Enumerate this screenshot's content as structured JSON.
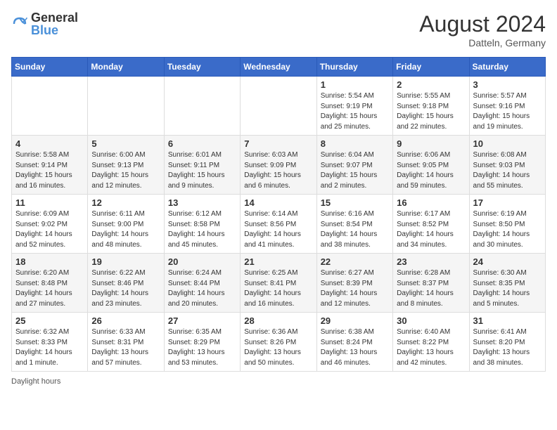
{
  "header": {
    "logo": {
      "general": "General",
      "blue": "Blue"
    },
    "title": "August 2024",
    "location": "Datteln, Germany"
  },
  "weekdays": [
    "Sunday",
    "Monday",
    "Tuesday",
    "Wednesday",
    "Thursday",
    "Friday",
    "Saturday"
  ],
  "weeks": [
    [
      {
        "day": "",
        "info": ""
      },
      {
        "day": "",
        "info": ""
      },
      {
        "day": "",
        "info": ""
      },
      {
        "day": "",
        "info": ""
      },
      {
        "day": "1",
        "info": "Sunrise: 5:54 AM\nSunset: 9:19 PM\nDaylight: 15 hours\nand 25 minutes."
      },
      {
        "day": "2",
        "info": "Sunrise: 5:55 AM\nSunset: 9:18 PM\nDaylight: 15 hours\nand 22 minutes."
      },
      {
        "day": "3",
        "info": "Sunrise: 5:57 AM\nSunset: 9:16 PM\nDaylight: 15 hours\nand 19 minutes."
      }
    ],
    [
      {
        "day": "4",
        "info": "Sunrise: 5:58 AM\nSunset: 9:14 PM\nDaylight: 15 hours\nand 16 minutes."
      },
      {
        "day": "5",
        "info": "Sunrise: 6:00 AM\nSunset: 9:13 PM\nDaylight: 15 hours\nand 12 minutes."
      },
      {
        "day": "6",
        "info": "Sunrise: 6:01 AM\nSunset: 9:11 PM\nDaylight: 15 hours\nand 9 minutes."
      },
      {
        "day": "7",
        "info": "Sunrise: 6:03 AM\nSunset: 9:09 PM\nDaylight: 15 hours\nand 6 minutes."
      },
      {
        "day": "8",
        "info": "Sunrise: 6:04 AM\nSunset: 9:07 PM\nDaylight: 15 hours\nand 2 minutes."
      },
      {
        "day": "9",
        "info": "Sunrise: 6:06 AM\nSunset: 9:05 PM\nDaylight: 14 hours\nand 59 minutes."
      },
      {
        "day": "10",
        "info": "Sunrise: 6:08 AM\nSunset: 9:03 PM\nDaylight: 14 hours\nand 55 minutes."
      }
    ],
    [
      {
        "day": "11",
        "info": "Sunrise: 6:09 AM\nSunset: 9:02 PM\nDaylight: 14 hours\nand 52 minutes."
      },
      {
        "day": "12",
        "info": "Sunrise: 6:11 AM\nSunset: 9:00 PM\nDaylight: 14 hours\nand 48 minutes."
      },
      {
        "day": "13",
        "info": "Sunrise: 6:12 AM\nSunset: 8:58 PM\nDaylight: 14 hours\nand 45 minutes."
      },
      {
        "day": "14",
        "info": "Sunrise: 6:14 AM\nSunset: 8:56 PM\nDaylight: 14 hours\nand 41 minutes."
      },
      {
        "day": "15",
        "info": "Sunrise: 6:16 AM\nSunset: 8:54 PM\nDaylight: 14 hours\nand 38 minutes."
      },
      {
        "day": "16",
        "info": "Sunrise: 6:17 AM\nSunset: 8:52 PM\nDaylight: 14 hours\nand 34 minutes."
      },
      {
        "day": "17",
        "info": "Sunrise: 6:19 AM\nSunset: 8:50 PM\nDaylight: 14 hours\nand 30 minutes."
      }
    ],
    [
      {
        "day": "18",
        "info": "Sunrise: 6:20 AM\nSunset: 8:48 PM\nDaylight: 14 hours\nand 27 minutes."
      },
      {
        "day": "19",
        "info": "Sunrise: 6:22 AM\nSunset: 8:46 PM\nDaylight: 14 hours\nand 23 minutes."
      },
      {
        "day": "20",
        "info": "Sunrise: 6:24 AM\nSunset: 8:44 PM\nDaylight: 14 hours\nand 20 minutes."
      },
      {
        "day": "21",
        "info": "Sunrise: 6:25 AM\nSunset: 8:41 PM\nDaylight: 14 hours\nand 16 minutes."
      },
      {
        "day": "22",
        "info": "Sunrise: 6:27 AM\nSunset: 8:39 PM\nDaylight: 14 hours\nand 12 minutes."
      },
      {
        "day": "23",
        "info": "Sunrise: 6:28 AM\nSunset: 8:37 PM\nDaylight: 14 hours\nand 8 minutes."
      },
      {
        "day": "24",
        "info": "Sunrise: 6:30 AM\nSunset: 8:35 PM\nDaylight: 14 hours\nand 5 minutes."
      }
    ],
    [
      {
        "day": "25",
        "info": "Sunrise: 6:32 AM\nSunset: 8:33 PM\nDaylight: 14 hours\nand 1 minute."
      },
      {
        "day": "26",
        "info": "Sunrise: 6:33 AM\nSunset: 8:31 PM\nDaylight: 13 hours\nand 57 minutes."
      },
      {
        "day": "27",
        "info": "Sunrise: 6:35 AM\nSunset: 8:29 PM\nDaylight: 13 hours\nand 53 minutes."
      },
      {
        "day": "28",
        "info": "Sunrise: 6:36 AM\nSunset: 8:26 PM\nDaylight: 13 hours\nand 50 minutes."
      },
      {
        "day": "29",
        "info": "Sunrise: 6:38 AM\nSunset: 8:24 PM\nDaylight: 13 hours\nand 46 minutes."
      },
      {
        "day": "30",
        "info": "Sunrise: 6:40 AM\nSunset: 8:22 PM\nDaylight: 13 hours\nand 42 minutes."
      },
      {
        "day": "31",
        "info": "Sunrise: 6:41 AM\nSunset: 8:20 PM\nDaylight: 13 hours\nand 38 minutes."
      }
    ]
  ],
  "footer": {
    "note": "Daylight hours"
  }
}
